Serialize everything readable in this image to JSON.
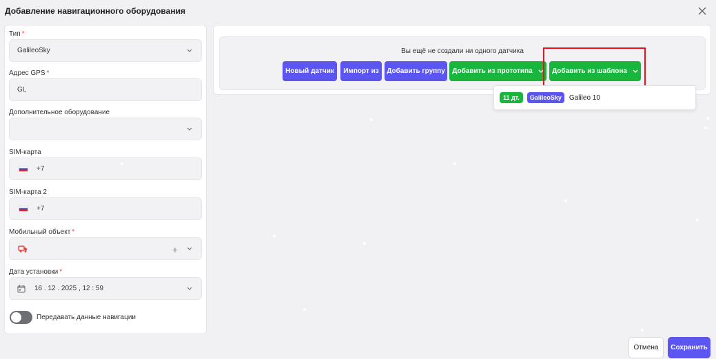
{
  "dialog": {
    "title": "Добавление навигационного оборудования"
  },
  "form": {
    "type": {
      "label": "Тип",
      "required": "*",
      "value": "GalileoSky"
    },
    "gps_address": {
      "label": "Адрес GPS",
      "required": "*",
      "value": "GL"
    },
    "extra_equipment": {
      "label": "Дополнительное оборудование",
      "value": ""
    },
    "sim1": {
      "label": "SIM-карта",
      "value": "+7"
    },
    "sim2": {
      "label": "SIM-карта 2",
      "value": "+7"
    },
    "mobile_object": {
      "label": "Мобильный объект",
      "required": "*",
      "value": ""
    },
    "install_date": {
      "label": "Дата установки",
      "required": "*",
      "value": "16 . 12 . 2025 , 12 : 59"
    },
    "nav_toggle": {
      "label": "Передавать данные навигации",
      "on": false
    }
  },
  "sensors": {
    "empty_text": "Вы ещё не создали ни одного датчика",
    "buttons": {
      "new_sensor": "Новый датчик",
      "import": "Импорт из",
      "add_group": "Добавить группу",
      "add_from_prototype": "Добавить из прототипа",
      "add_from_template": "Добавить из шаблона"
    },
    "template_dropdown": {
      "items": [
        {
          "count": "11 дт.",
          "model": "GalileoSky",
          "name": "Galileo 10"
        }
      ]
    }
  },
  "footer": {
    "cancel": "Отмена",
    "save": "Сохранить"
  },
  "colors": {
    "primary": "#5b55f2",
    "success": "#19b63e",
    "highlight": "#e8111c",
    "required": "#e53935"
  }
}
